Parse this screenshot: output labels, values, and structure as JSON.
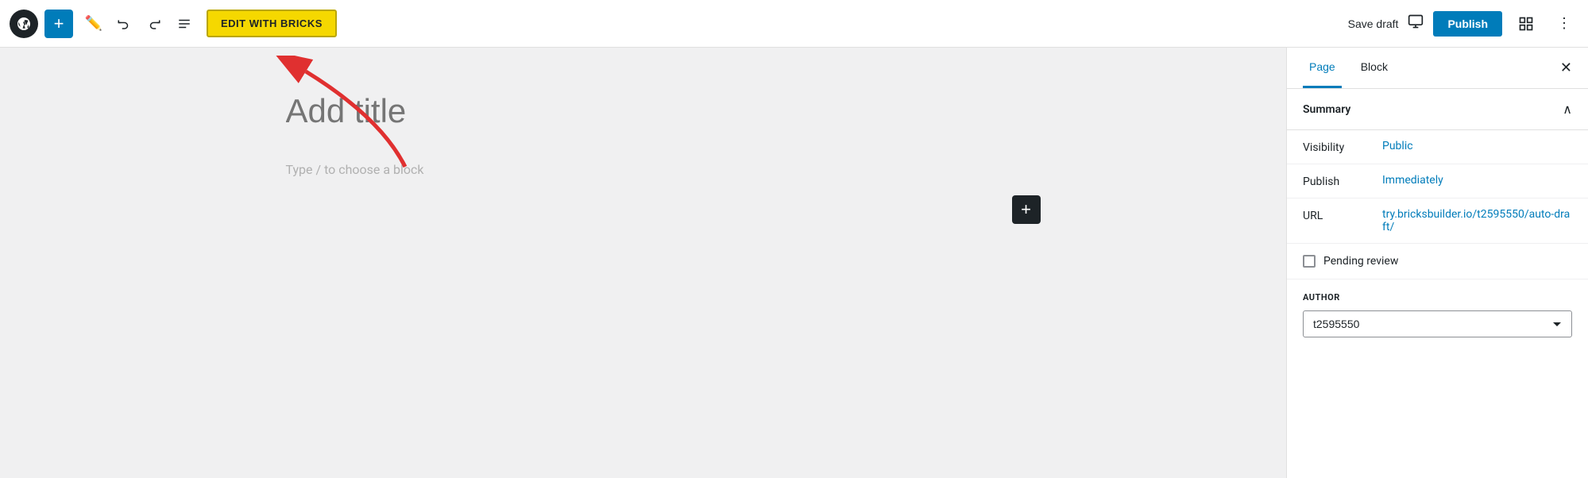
{
  "toolbar": {
    "add_label": "+",
    "edit_with_bricks_label": "EDIT WITH BRICKS",
    "save_draft_label": "Save draft",
    "publish_label": "Publish"
  },
  "editor": {
    "title_placeholder": "Add title",
    "block_placeholder": "Type / to choose a block"
  },
  "sidebar": {
    "tab_page_label": "Page",
    "tab_block_label": "Block",
    "summary_label": "Summary",
    "visibility_label": "Visibility",
    "visibility_value": "Public",
    "publish_label": "Publish",
    "publish_value": "Immediately",
    "url_label": "URL",
    "url_value": "try.bricksbuilder.io/t2595550/auto-draft/",
    "pending_review_label": "Pending review",
    "author_label": "AUTHOR",
    "author_value": "t2595550",
    "author_options": [
      "t2595550"
    ]
  }
}
